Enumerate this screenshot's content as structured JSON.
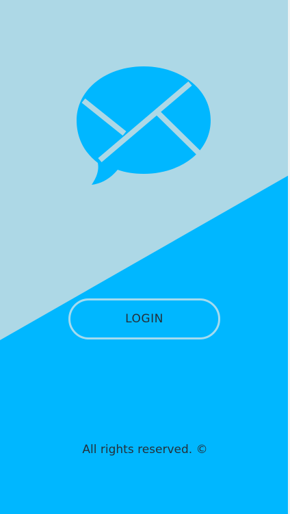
{
  "app": {
    "accent_color": "#00b7ff",
    "background_top_color": "#add8e6",
    "text_color": "#24303a",
    "logo_icon": "chat-envelope-icon"
  },
  "login": {
    "label": "LOGIN"
  },
  "footer": {
    "text": "All rights reserved. ©"
  }
}
